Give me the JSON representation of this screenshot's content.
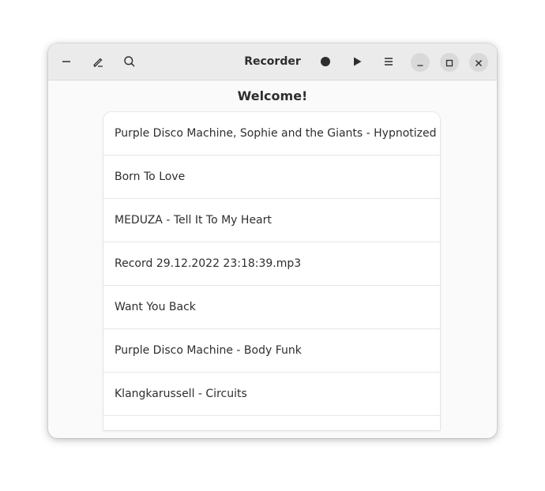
{
  "window": {
    "title": "Recorder"
  },
  "main": {
    "heading": "Welcome!",
    "recordings": [
      "Purple Disco Machine, Sophie and the Giants - Hypnotized",
      "Born To Love",
      "MEDUZA - Tell It To My Heart",
      "Record 29.12.2022  23:18:39.mp3",
      "Want You Back",
      "Purple Disco Machine - Body Funk",
      "Klangkarussell - Circuits",
      ""
    ]
  },
  "icons": {
    "collapse": "minus-icon",
    "edit": "pencil-icon",
    "search": "search-icon",
    "record": "record-icon",
    "play": "play-icon",
    "menu": "hamburger-menu-icon",
    "minimize": "minimize-icon",
    "maximize": "maximize-icon",
    "close": "close-icon"
  },
  "colors": {
    "headerbar": "#ebebeb",
    "window_bg": "#fafafa",
    "list_bg": "#ffffff",
    "text": "#2e2e2e"
  }
}
